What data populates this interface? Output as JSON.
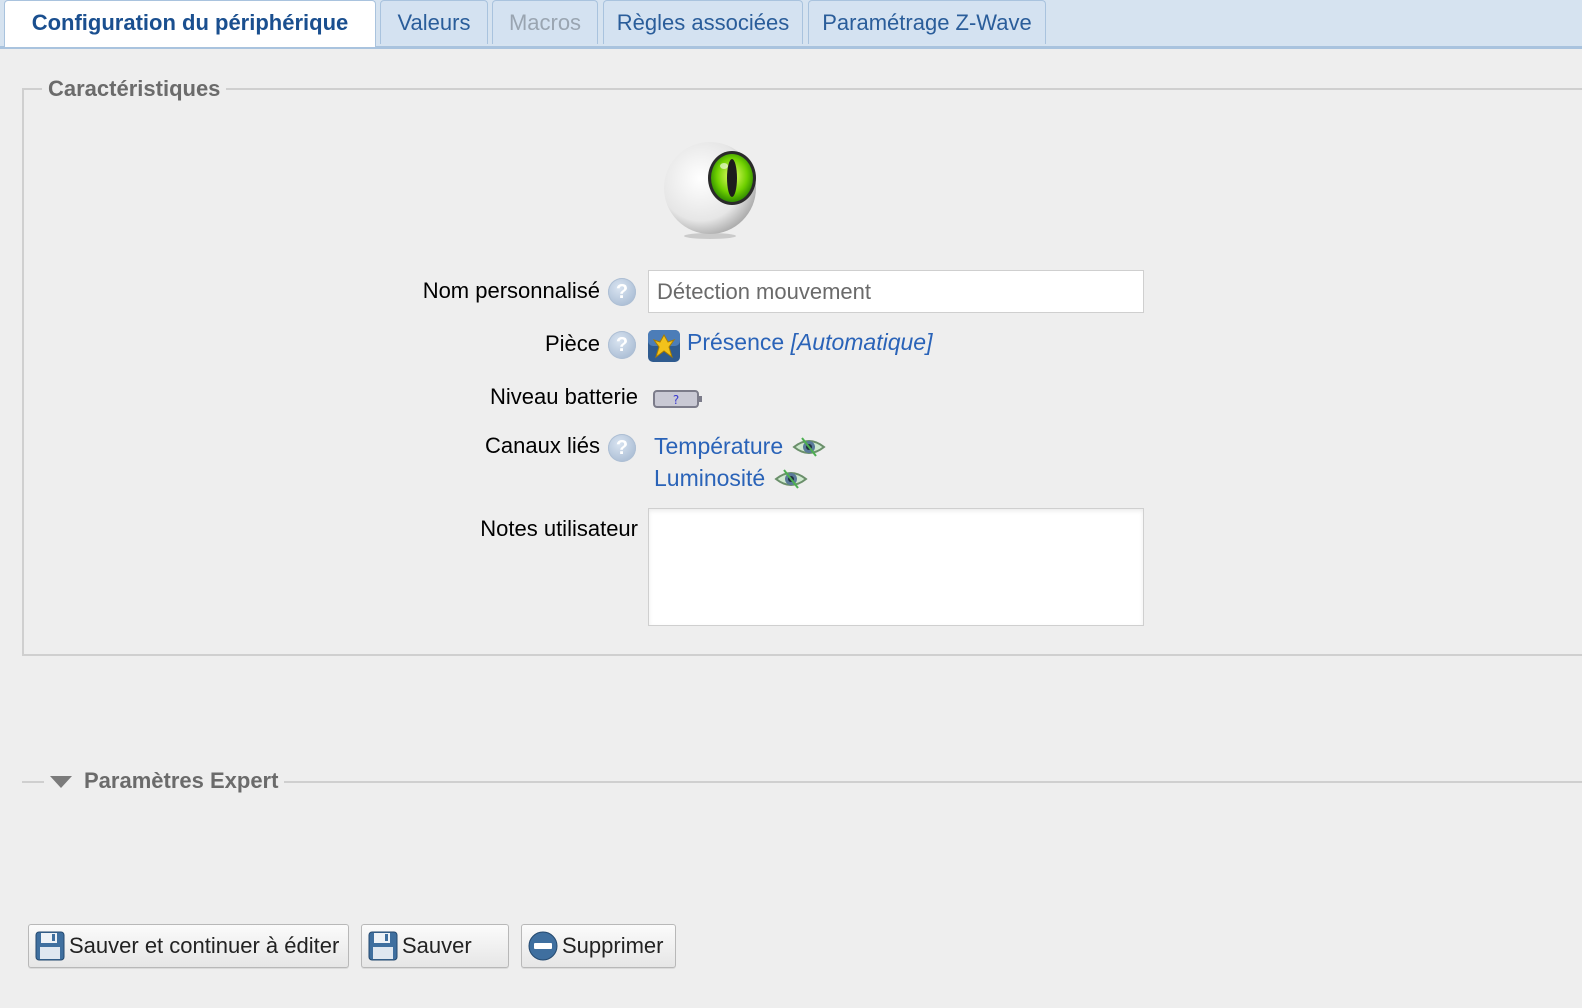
{
  "tabs": [
    {
      "label": "Configuration du périphérique",
      "state": "active"
    },
    {
      "label": "Valeurs",
      "state": "normal"
    },
    {
      "label": "Macros",
      "state": "disabled"
    },
    {
      "label": "Règles associées",
      "state": "normal"
    },
    {
      "label": "Paramétrage Z-Wave",
      "state": "normal"
    }
  ],
  "section": {
    "legend": "Caractéristiques",
    "device_icon": "motion-sensor-eye-icon"
  },
  "form": {
    "name_label": "Nom personnalisé",
    "name_value": "Détection mouvement",
    "room_label": "Pièce",
    "room_name": "Présence",
    "room_mode": "[Automatique]",
    "battery_label": "Niveau batterie",
    "battery_value": "?",
    "channels_label": "Canaux liés",
    "channels": [
      "Température",
      "Luminosité"
    ],
    "notes_label": "Notes utilisateur",
    "notes_value": ""
  },
  "expert": {
    "legend": "Paramètres Expert"
  },
  "buttons": {
    "save_continue": "Sauver et continuer à éditer",
    "save": "Sauver",
    "delete": "Supprimer"
  },
  "colors": {
    "link": "#2a63b8",
    "tab_active_text": "#1a4f8f",
    "background": "#eeeeee"
  }
}
